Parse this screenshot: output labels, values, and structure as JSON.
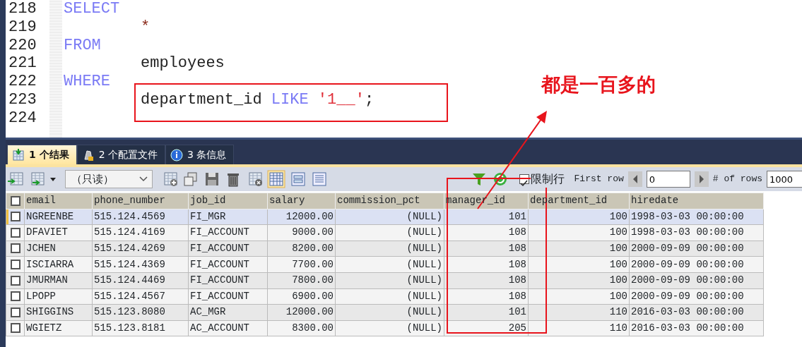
{
  "editor": {
    "lines": [
      {
        "number": "218",
        "tokens": [
          {
            "kind": "keyword",
            "text": "SELECT"
          }
        ],
        "children": [
          {
            "number": "219",
            "tokens": [
              {
                "kind": "operator",
                "text": "*"
              }
            ]
          }
        ]
      },
      {
        "number": "220",
        "tokens": [
          {
            "kind": "keyword",
            "text": "FROM"
          }
        ],
        "children": [
          {
            "number": "221",
            "tokens": [
              {
                "kind": "plain",
                "text": "employees"
              }
            ]
          }
        ]
      },
      {
        "number": "222",
        "tokens": [
          {
            "kind": "keyword",
            "text": "WHERE"
          }
        ],
        "children": [
          {
            "number": "223",
            "tokens": [
              {
                "kind": "plain",
                "text": "department_id "
              },
              {
                "kind": "keyword",
                "text": "LIKE "
              },
              {
                "kind": "string",
                "text": "'1__'"
              },
              {
                "kind": "plain",
                "text": ";"
              }
            ]
          }
        ]
      },
      {
        "number": "224"
      }
    ]
  },
  "tabs": [
    {
      "label": "1 个结果",
      "selected": true,
      "kind": "result"
    },
    {
      "label": "2 个配置文件",
      "selected": false,
      "kind": "profile"
    },
    {
      "label": "3 条信息",
      "selected": false,
      "kind": "info"
    }
  ],
  "toolbar": {
    "mode_select": "（只读）",
    "limit_rows": {
      "label": "限制行",
      "checked": true
    },
    "first_row_label": "First row",
    "first_row": "0",
    "rows_label": "# of rows",
    "rows": "1000"
  },
  "table": {
    "select_all_checked": false,
    "columns": [
      {
        "name": "email",
        "kind": "text"
      },
      {
        "name": "phone_number",
        "kind": "text"
      },
      {
        "name": "job_id",
        "kind": "text"
      },
      {
        "name": "salary",
        "kind": "number"
      },
      {
        "name": "commission_pct",
        "kind": "number"
      },
      {
        "name": "manager_id",
        "kind": "number"
      },
      {
        "name": "department_id",
        "kind": "number"
      },
      {
        "name": "hiredate",
        "kind": "text"
      }
    ],
    "rows": [
      {
        "selected": true,
        "checked": false,
        "cells": [
          "NGREENBE",
          "515.124.4569",
          "FI_MGR",
          "12000.00",
          "(NULL)",
          "101",
          "100",
          "1998-03-03 00:00:00"
        ]
      },
      {
        "selected": false,
        "checked": false,
        "cells": [
          "DFAVIET",
          "515.124.4169",
          "FI_ACCOUNT",
          "9000.00",
          "(NULL)",
          "108",
          "100",
          "1998-03-03 00:00:00"
        ]
      },
      {
        "selected": false,
        "checked": false,
        "cells": [
          "JCHEN",
          "515.124.4269",
          "FI_ACCOUNT",
          "8200.00",
          "(NULL)",
          "108",
          "100",
          "2000-09-09 00:00:00"
        ]
      },
      {
        "selected": false,
        "checked": false,
        "cells": [
          "ISCIARRA",
          "515.124.4369",
          "FI_ACCOUNT",
          "7700.00",
          "(NULL)",
          "108",
          "100",
          "2000-09-09 00:00:00"
        ]
      },
      {
        "selected": false,
        "checked": false,
        "cells": [
          "JMURMAN",
          "515.124.4469",
          "FI_ACCOUNT",
          "7800.00",
          "(NULL)",
          "108",
          "100",
          "2000-09-09 00:00:00"
        ]
      },
      {
        "selected": false,
        "checked": false,
        "cells": [
          "LPOPP",
          "515.124.4567",
          "FI_ACCOUNT",
          "6900.00",
          "(NULL)",
          "108",
          "100",
          "2000-09-09 00:00:00"
        ]
      },
      {
        "selected": false,
        "checked": false,
        "cells": [
          "SHIGGINS",
          "515.123.8080",
          "AC_MGR",
          "12000.00",
          "(NULL)",
          "101",
          "110",
          "2016-03-03 00:00:00"
        ]
      },
      {
        "selected": false,
        "checked": false,
        "cells": [
          "WGIETZ",
          "515.123.8181",
          "AC_ACCOUNT",
          "8300.00",
          "(NULL)",
          "205",
          "110",
          "2016-03-03 00:00:00"
        ]
      }
    ]
  },
  "annotation": {
    "text": "都是一百多的"
  }
}
